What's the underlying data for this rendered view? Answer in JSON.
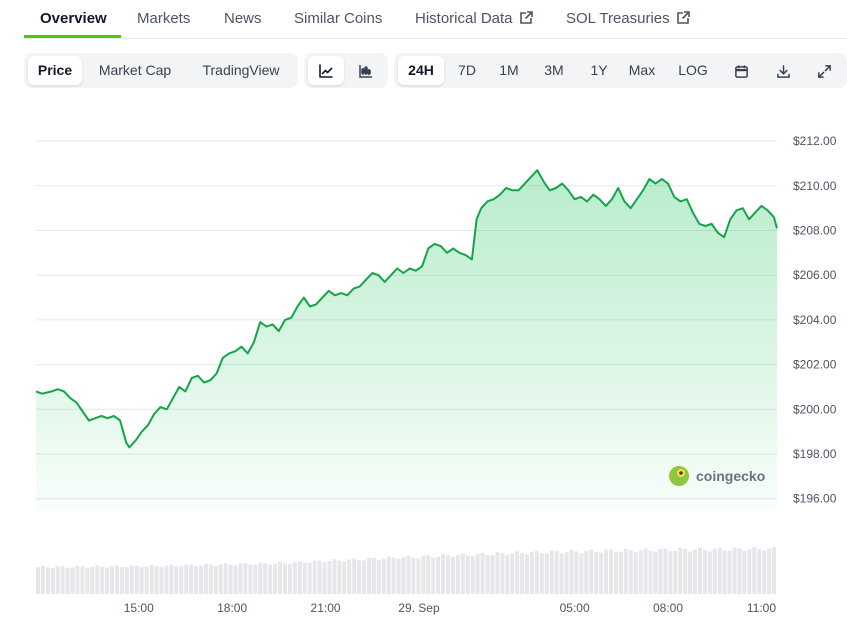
{
  "tabs": [
    {
      "label": "Overview",
      "active": true,
      "external": false
    },
    {
      "label": "Markets",
      "active": false,
      "external": false
    },
    {
      "label": "News",
      "active": false,
      "external": false
    },
    {
      "label": "Similar Coins",
      "active": false,
      "external": false
    },
    {
      "label": "Historical Data",
      "active": false,
      "external": true
    },
    {
      "label": "SOL Treasuries",
      "active": false,
      "external": true
    }
  ],
  "chart_type_toggle": {
    "options": [
      "Price",
      "Market Cap",
      "TradingView"
    ],
    "selected": "Price"
  },
  "view_toggle": {
    "options": [
      {
        "icon": "line-chart-icon",
        "selected": true
      },
      {
        "icon": "candlestick-icon",
        "selected": false
      }
    ]
  },
  "range_toggle": {
    "options": [
      "24H",
      "7D",
      "1M",
      "3M",
      "1Y",
      "Max",
      "LOG"
    ],
    "selected": "24H"
  },
  "tool_icons": [
    "calendar-icon",
    "download-icon",
    "fullscreen-icon"
  ],
  "watermark": "coingecko",
  "colors": {
    "accent": "#4bcc00",
    "line": "#16a34a",
    "fill": "#22c55e",
    "grid": "#e5e7eb",
    "volume": "#e5e7eb"
  },
  "chart_data": {
    "type": "area",
    "y_unit": "USD",
    "ylim": [
      195.5,
      212.5
    ],
    "y_ticks": [
      "$212.00",
      "$210.00",
      "$208.00",
      "$206.00",
      "$204.00",
      "$202.00",
      "$200.00",
      "$198.00",
      "$196.00"
    ],
    "y_tick_values": [
      212,
      210,
      208,
      206,
      204,
      202,
      200,
      198,
      196
    ],
    "x_ticks": [
      "15:00",
      "18:00",
      "21:00",
      "29. Sep",
      "05:00",
      "08:00",
      "11:00"
    ],
    "x_tick_hours": [
      3.3,
      6.3,
      9.3,
      12.3,
      17.3,
      20.3,
      23.3
    ],
    "x_range_hours": [
      0,
      23.8
    ],
    "grid": true,
    "series": [
      {
        "points": [
          [
            0.0,
            200.8
          ],
          [
            0.2,
            200.7
          ],
          [
            0.5,
            200.8
          ],
          [
            0.7,
            200.9
          ],
          [
            0.9,
            200.8
          ],
          [
            1.1,
            200.5
          ],
          [
            1.3,
            200.3
          ],
          [
            1.5,
            199.9
          ],
          [
            1.7,
            199.5
          ],
          [
            1.9,
            199.6
          ],
          [
            2.1,
            199.7
          ],
          [
            2.3,
            199.6
          ],
          [
            2.5,
            199.7
          ],
          [
            2.7,
            199.5
          ],
          [
            2.9,
            198.5
          ],
          [
            3.0,
            198.3
          ],
          [
            3.2,
            198.6
          ],
          [
            3.4,
            199.0
          ],
          [
            3.6,
            199.3
          ],
          [
            3.8,
            199.8
          ],
          [
            4.0,
            200.1
          ],
          [
            4.2,
            200.0
          ],
          [
            4.4,
            200.5
          ],
          [
            4.6,
            201.0
          ],
          [
            4.8,
            200.8
          ],
          [
            5.0,
            201.4
          ],
          [
            5.2,
            201.5
          ],
          [
            5.4,
            201.2
          ],
          [
            5.6,
            201.3
          ],
          [
            5.8,
            201.6
          ],
          [
            6.0,
            202.3
          ],
          [
            6.2,
            202.5
          ],
          [
            6.4,
            202.6
          ],
          [
            6.6,
            202.8
          ],
          [
            6.8,
            202.5
          ],
          [
            7.0,
            203.0
          ],
          [
            7.2,
            203.9
          ],
          [
            7.4,
            203.7
          ],
          [
            7.6,
            203.8
          ],
          [
            7.8,
            203.5
          ],
          [
            8.0,
            204.0
          ],
          [
            8.2,
            204.1
          ],
          [
            8.4,
            204.6
          ],
          [
            8.6,
            205.0
          ],
          [
            8.8,
            204.6
          ],
          [
            9.0,
            204.7
          ],
          [
            9.2,
            205.0
          ],
          [
            9.4,
            205.3
          ],
          [
            9.6,
            205.1
          ],
          [
            9.8,
            205.2
          ],
          [
            10.0,
            205.1
          ],
          [
            10.2,
            205.4
          ],
          [
            10.4,
            205.5
          ],
          [
            10.6,
            205.8
          ],
          [
            10.8,
            206.1
          ],
          [
            11.0,
            206.0
          ],
          [
            11.2,
            205.7
          ],
          [
            11.4,
            206.0
          ],
          [
            11.6,
            206.3
          ],
          [
            11.8,
            206.1
          ],
          [
            12.0,
            206.3
          ],
          [
            12.2,
            206.2
          ],
          [
            12.4,
            206.4
          ],
          [
            12.6,
            207.2
          ],
          [
            12.8,
            207.4
          ],
          [
            13.0,
            207.3
          ],
          [
            13.2,
            207.0
          ],
          [
            13.4,
            207.2
          ],
          [
            13.6,
            207.0
          ],
          [
            13.8,
            206.9
          ],
          [
            14.0,
            206.7
          ],
          [
            14.15,
            208.5
          ],
          [
            14.3,
            209.0
          ],
          [
            14.5,
            209.3
          ],
          [
            14.7,
            209.4
          ],
          [
            14.9,
            209.6
          ],
          [
            15.1,
            209.9
          ],
          [
            15.3,
            209.8
          ],
          [
            15.5,
            209.8
          ],
          [
            15.7,
            210.1
          ],
          [
            15.9,
            210.4
          ],
          [
            16.1,
            210.7
          ],
          [
            16.3,
            210.2
          ],
          [
            16.5,
            209.8
          ],
          [
            16.7,
            209.9
          ],
          [
            16.9,
            210.1
          ],
          [
            17.1,
            209.8
          ],
          [
            17.3,
            209.4
          ],
          [
            17.5,
            209.5
          ],
          [
            17.7,
            209.3
          ],
          [
            17.9,
            209.6
          ],
          [
            18.1,
            209.4
          ],
          [
            18.3,
            209.1
          ],
          [
            18.5,
            209.4
          ],
          [
            18.7,
            209.9
          ],
          [
            18.9,
            209.3
          ],
          [
            19.1,
            209.0
          ],
          [
            19.3,
            209.4
          ],
          [
            19.5,
            209.8
          ],
          [
            19.7,
            210.3
          ],
          [
            19.9,
            210.1
          ],
          [
            20.1,
            210.3
          ],
          [
            20.3,
            210.1
          ],
          [
            20.5,
            209.5
          ],
          [
            20.7,
            209.3
          ],
          [
            20.9,
            209.4
          ],
          [
            21.1,
            208.8
          ],
          [
            21.3,
            208.3
          ],
          [
            21.5,
            208.2
          ],
          [
            21.7,
            208.3
          ],
          [
            21.9,
            207.9
          ],
          [
            22.1,
            207.7
          ],
          [
            22.3,
            208.5
          ],
          [
            22.5,
            208.9
          ],
          [
            22.7,
            209.0
          ],
          [
            22.9,
            208.5
          ],
          [
            23.1,
            208.8
          ],
          [
            23.3,
            209.1
          ],
          [
            23.5,
            208.9
          ],
          [
            23.7,
            208.6
          ],
          [
            23.8,
            208.1
          ]
        ]
      }
    ],
    "volume_trend": [
      [
        0.0,
        0.45
      ],
      [
        4.0,
        0.47
      ],
      [
        8.0,
        0.52
      ],
      [
        12.0,
        0.62
      ],
      [
        16.0,
        0.7
      ],
      [
        20.0,
        0.74
      ],
      [
        23.8,
        0.76
      ]
    ]
  }
}
